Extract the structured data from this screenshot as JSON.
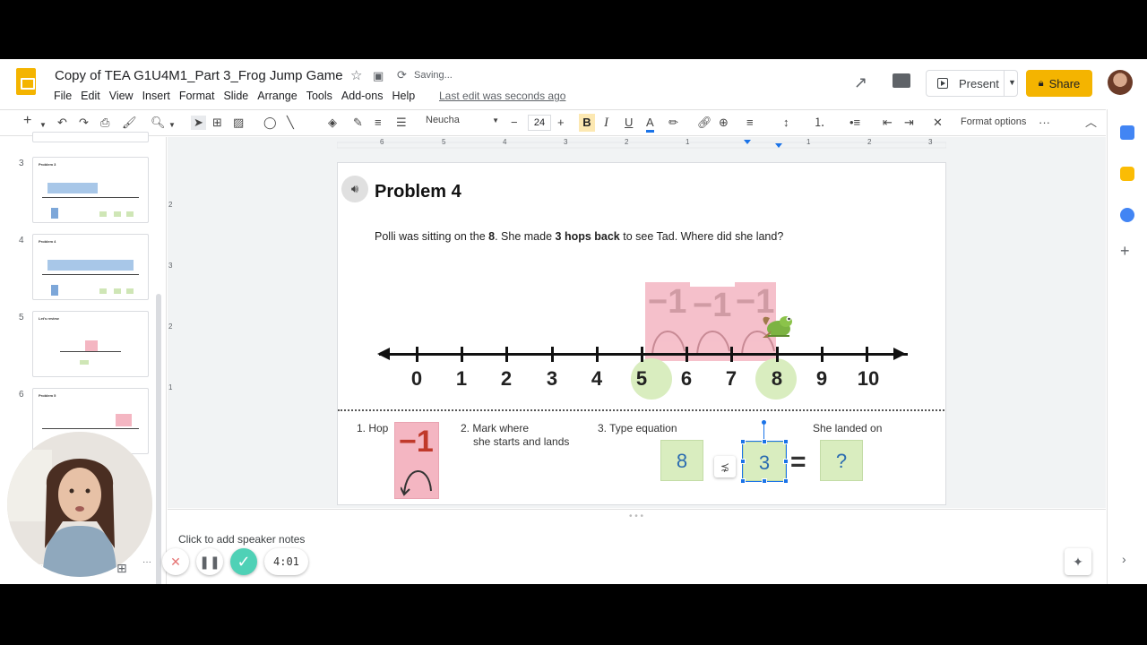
{
  "app": {
    "title": "Copy of TEA G1U4M1_Part 3_Frog Jump Game",
    "saving": "Saving...",
    "last_edit": "Last edit was seconds ago",
    "menu": [
      "File",
      "Edit",
      "View",
      "Insert",
      "Format",
      "Slide",
      "Arrange",
      "Tools",
      "Add-ons",
      "Help"
    ],
    "present_label": "Present",
    "share_label": "Share",
    "brand_color": "#f4b400"
  },
  "toolbar": {
    "font": "Neucha",
    "font_size": "24",
    "bold": "B",
    "italic": "I",
    "underline": "U",
    "text_color": "A",
    "format_options": "Format options",
    "more": "···"
  },
  "rulers": {
    "horizontal": [
      "6",
      "5",
      "4",
      "3",
      "2",
      "1",
      "1",
      "2",
      "3"
    ],
    "vertical": [
      "2",
      "3",
      "2",
      "1"
    ]
  },
  "slides": [
    {
      "num": "3",
      "title": "Problem 3"
    },
    {
      "num": "4",
      "title": "Problem 4"
    },
    {
      "num": "5",
      "title": "Let's review"
    },
    {
      "num": "6",
      "title": "Problem 5"
    }
  ],
  "slide": {
    "title": "Problem 4",
    "text_a": "Polli was sitting on the ",
    "text_b": "8",
    "text_c": ". She made ",
    "text_d": "3 hops back",
    "text_e": " to see Tad. Where did she land?",
    "hop_label": "−1",
    "number_line": [
      "0",
      "1",
      "2",
      "3",
      "4",
      "5",
      "6",
      "7",
      "8",
      "9",
      "10"
    ],
    "highlighted": [
      "5",
      "8"
    ],
    "step1": "1. Hop",
    "step2a": "2. Mark where",
    "step2b": "she starts and lands",
    "step3": "3. Type equation",
    "step4": "She landed on",
    "card_minus": "−1",
    "eq_start": "8",
    "eq_sub": "3",
    "eq_equals": "=",
    "eq_result": "?"
  },
  "notes": {
    "placeholder": "Click to add speaker notes"
  },
  "recorder": {
    "time": "4:01"
  }
}
